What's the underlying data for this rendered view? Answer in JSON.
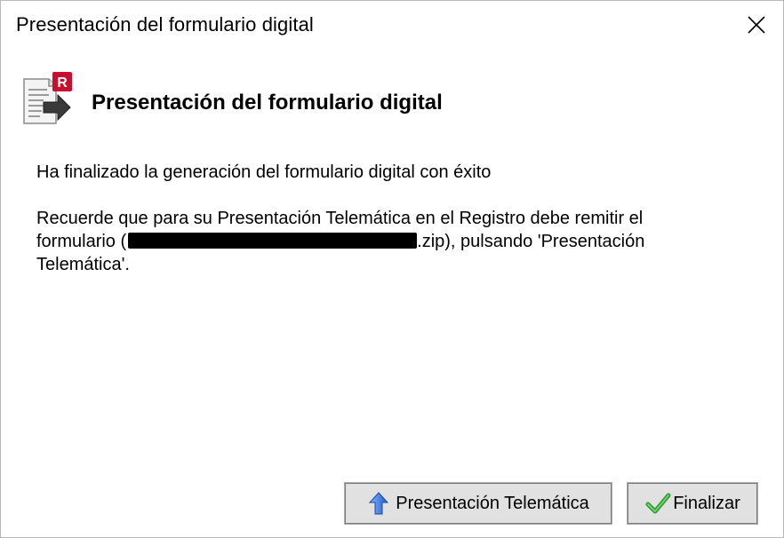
{
  "window": {
    "title": "Presentación del formulario digital",
    "close_label": "Close"
  },
  "header": {
    "icon": "document-send-icon",
    "title": "Presentación del formulario digital"
  },
  "content": {
    "message_success": "Ha finalizado la generación del formulario digital con éxito",
    "message_part1": "Recuerde que para su Presentación Telemática en el Registro debe remitir el formulario (",
    "message_part2": ".zip), pulsando 'Presentación Telemática'."
  },
  "buttons": {
    "presentacion": {
      "label": "Presentación Telemática",
      "icon": "arrow-up-icon"
    },
    "finalizar": {
      "label": "Finalizar",
      "icon": "checkmark-icon"
    }
  },
  "colors": {
    "accent_red": "#c8102e",
    "arrow_blue": "#2f6fd1",
    "check_green": "#3aa83a"
  }
}
